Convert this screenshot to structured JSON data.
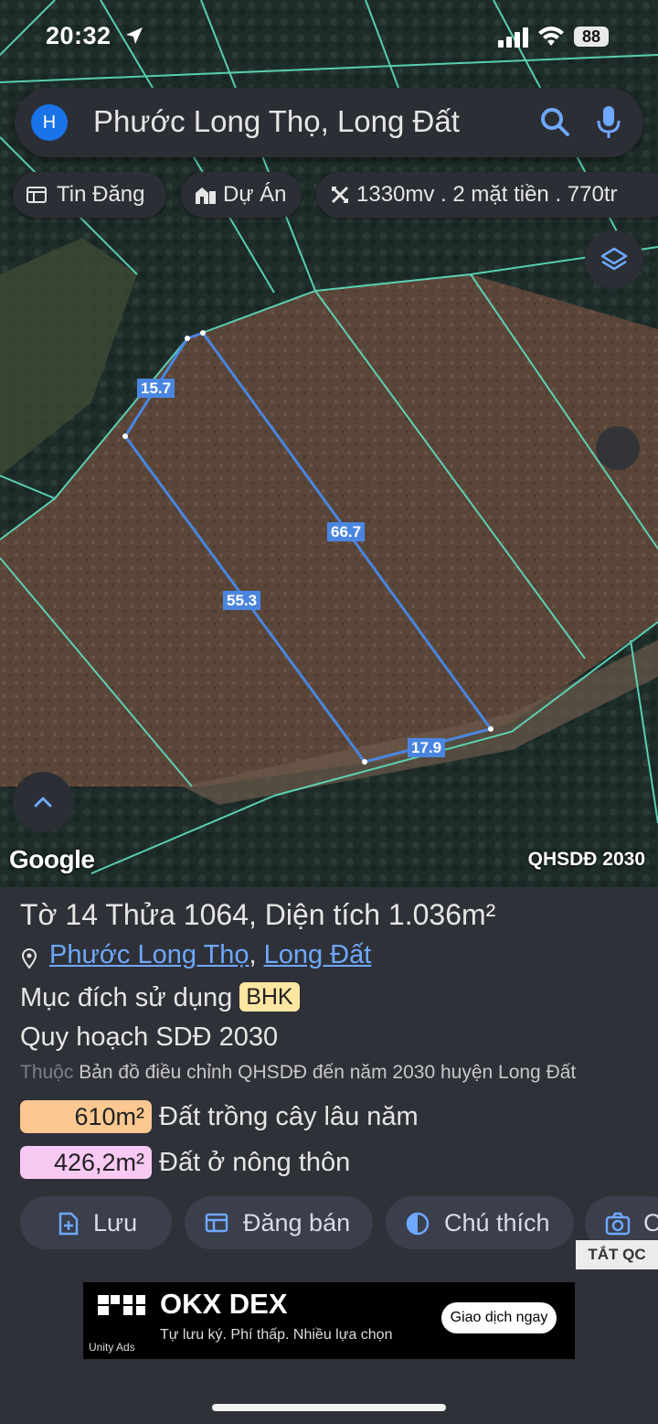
{
  "status_bar": {
    "time": "20:32",
    "battery": "88"
  },
  "search": {
    "avatar_letter": "H",
    "query": "Phước Long Thọ, Long Đất"
  },
  "chips": [
    {
      "label": "Tin Đăng",
      "icon": "listing-icon"
    },
    {
      "label": "Dự Án",
      "icon": "building-icon"
    },
    {
      "label": "1330mv . 2 mặt tiền . 770tr",
      "icon": "measure-icon"
    }
  ],
  "map": {
    "brand": "Google",
    "layer_name": "QHSDĐ 2030",
    "measurements": [
      "15.7",
      "66.7",
      "55.3",
      "17.9"
    ]
  },
  "parcel": {
    "title": "Tờ 14 Thửa 1064, Diện tích 1.036m²",
    "ward": "Phước Long Thọ",
    "separator": ",",
    "district": "Long Đất",
    "purpose_label": "Mục đích sử dụng",
    "purpose_code": "BHK",
    "plan_label": "Quy hoạch SDĐ 2030",
    "source_prefix": "Thuộc",
    "source_text": "Bản đồ điều chỉnh QHSDĐ đến năm 2030 huyện Long Đất",
    "areas": [
      {
        "value": "610m²",
        "label": "Đất trồng cây lâu năm",
        "color": "#fbc891"
      },
      {
        "value": "426,2m²",
        "label": "Đất ở nông thôn",
        "color": "#f8c9f3"
      }
    ]
  },
  "actions": [
    {
      "label": "Lưu",
      "icon": "save-icon"
    },
    {
      "label": "Đăng bán",
      "icon": "post-icon"
    },
    {
      "label": "Chú thích",
      "icon": "legend-icon"
    },
    {
      "label": "C",
      "icon": "camera-icon"
    }
  ],
  "ad": {
    "close_label": "TẮT QC",
    "brand": "OKX DEX",
    "tagline": "Tự lưu ký. Phí thấp. Nhiều lựa chọn",
    "cta": "Giao dịch ngay",
    "network": "Unity Ads"
  },
  "colors": {
    "accent": "#1a73e8",
    "parcel_line": "#4a86e0",
    "boundary": "#5fe0c0",
    "panel_bg": "#2f3138"
  }
}
